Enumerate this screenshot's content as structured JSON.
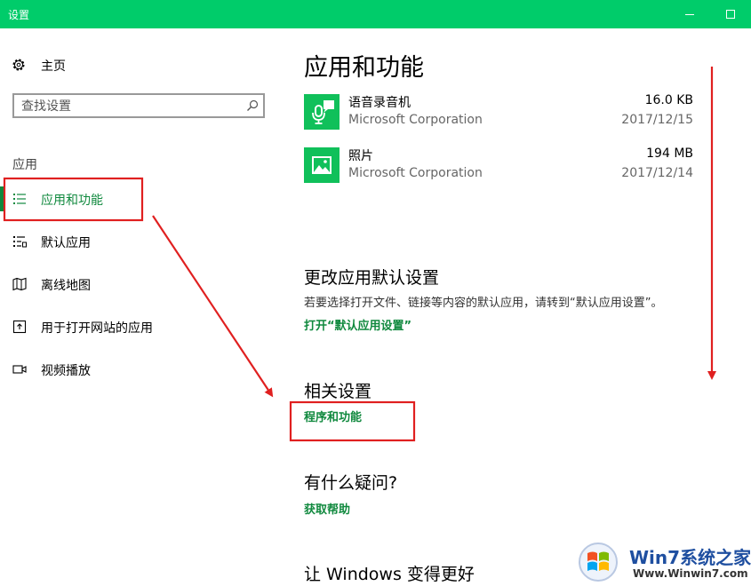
{
  "window": {
    "title": "设置"
  },
  "sidebar": {
    "home_label": "主页",
    "search_placeholder": "查找设置",
    "section_title": "应用",
    "items": [
      {
        "label": "应用和功能",
        "icon": "apps-list-icon",
        "active": true
      },
      {
        "label": "默认应用",
        "icon": "default-apps-icon",
        "active": false
      },
      {
        "label": "离线地图",
        "icon": "offline-map-icon",
        "active": false
      },
      {
        "label": "用于打开网站的应用",
        "icon": "open-website-icon",
        "active": false
      },
      {
        "label": "视频播放",
        "icon": "video-playback-icon",
        "active": false
      }
    ]
  },
  "main": {
    "title": "应用和功能",
    "apps": [
      {
        "name": "语音录音机",
        "publisher": "Microsoft Corporation",
        "size": "16.0 KB",
        "date": "2017/12/15",
        "icon": "voice-recorder-icon"
      },
      {
        "name": "照片",
        "publisher": "Microsoft Corporation",
        "size": "194 MB",
        "date": "2017/12/14",
        "icon": "photos-icon"
      }
    ],
    "default_settings": {
      "title": "更改应用默认设置",
      "description": "若要选择打开文件、链接等内容的默认应用，请转到“默认应用设置”。",
      "link": "打开“默认应用设置”"
    },
    "related": {
      "title": "相关设置",
      "link": "程序和功能"
    },
    "question": {
      "title": "有什么疑问?",
      "link": "获取帮助"
    },
    "feedback": {
      "title": "让 Windows 变得更好"
    }
  },
  "watermark": {
    "brand": "Win7系统之家",
    "url": "Www.Winwin7.com"
  },
  "colors": {
    "titlebar": "#00cc6a",
    "accent": "#10893e",
    "tile": "#10c05a",
    "annotation": "#e02020"
  }
}
